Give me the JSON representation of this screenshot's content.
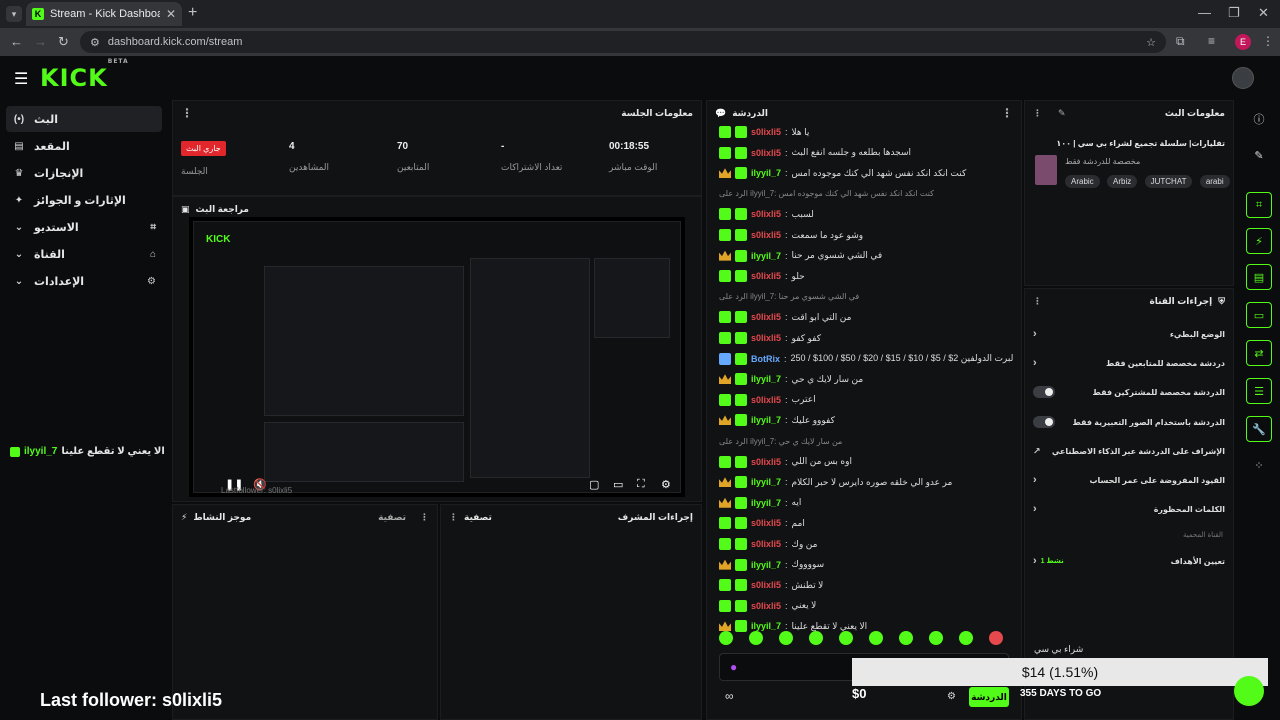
{
  "browser": {
    "tab_title": "Stream - Kick Dashboard",
    "url": "dashboard.kick.com/stream",
    "profile_letter": "E"
  },
  "sidebar": {
    "items": [
      {
        "label": "البث",
        "icon": "(•)"
      },
      {
        "label": "المقعد",
        "icon": "▤"
      },
      {
        "label": "الإنجازات",
        "icon": "🏆"
      },
      {
        "label": "الإثارات و الجوائز",
        "icon": "✦"
      },
      {
        "label": "الاستديو",
        "icon": "▾"
      },
      {
        "label": "القناة",
        "icon": "▾"
      },
      {
        "label": "الإعدادات",
        "icon": "▾"
      }
    ],
    "pinned_message_user": "ilyyil_7",
    "pinned_message_text": "الا يعني لا تقطع علينا"
  },
  "session": {
    "title": "معلومات الجلسة",
    "live_badge": "جاري البث",
    "stats": [
      {
        "value": "00:18:55",
        "label": "الوقت مباشر"
      },
      {
        "value": "-",
        "label": "تعداد الاشتراكات"
      },
      {
        "value": "70",
        "label": "المتابعين"
      },
      {
        "value": "4",
        "label": "المشاهدين"
      },
      {
        "value": "",
        "label": "الجلسة"
      }
    ]
  },
  "preview": {
    "title": "مراجعة البث",
    "logo": "KICK",
    "watermark": "Lastfollower: s0lixli5"
  },
  "activity": {
    "title": "موجز النشاط",
    "filter": "تصفية"
  },
  "mod_actions": {
    "title": "إجراءات المشرف",
    "filter": "تصفية"
  },
  "chat": {
    "title": "الدردشة",
    "button": "الدردشة",
    "lines": [
      {
        "badge": "green",
        "user": "s0lixli5",
        "ucolor": "red",
        "text": "يا هلا"
      },
      {
        "badge": "green",
        "user": "s0lixli5",
        "ucolor": "red",
        "text": "اسجدها بطلعه و جلسه انفع البث"
      },
      {
        "badge": "crown",
        "user": "ilyyil_7",
        "ucolor": "green",
        "text": "كنت انكد انكد نفس شهد الي كنك موجوده امس"
      },
      {
        "badge": "reply",
        "user": "",
        "ucolor": "",
        "text": "الرد على ilyyil_7: كنت انكد انكد نفس شهد الي كنك موجوده امس"
      },
      {
        "badge": "green",
        "user": "s0lixli5",
        "ucolor": "red",
        "text": "لسبب"
      },
      {
        "badge": "green",
        "user": "s0lixli5",
        "ucolor": "red",
        "text": "وشو عود ما سمعت"
      },
      {
        "badge": "crown",
        "user": "ilyyil_7",
        "ucolor": "green",
        "text": "في الشي شسوي مر حنا"
      },
      {
        "badge": "green",
        "user": "s0lixli5",
        "ucolor": "red",
        "text": "حلو"
      },
      {
        "badge": "reply",
        "user": "",
        "ucolor": "",
        "text": "الرد على ilyyil_7: في الشي شسوي مر حنا"
      },
      {
        "badge": "green",
        "user": "s0lixli5",
        "ucolor": "red",
        "text": "من التي ابو اقت"
      },
      {
        "badge": "green",
        "user": "s0lixli5",
        "ucolor": "red",
        "text": "كفو كفو"
      },
      {
        "badge": "bot",
        "user": "BotRix",
        "ucolor": "blue",
        "text": "البرت الدولفين 2$ / 5$ / 10$ / 15$ / 20$ / 50$ / 100$ / 250$"
      },
      {
        "badge": "crown",
        "user": "ilyyil_7",
        "ucolor": "green",
        "text": "من سار لايك ي حي"
      },
      {
        "badge": "green",
        "user": "s0lixli5",
        "ucolor": "red",
        "text": "اعترب"
      },
      {
        "badge": "crown",
        "user": "ilyyil_7",
        "ucolor": "green",
        "text": "كفووو عليك"
      },
      {
        "badge": "reply",
        "user": "",
        "ucolor": "",
        "text": "الرد على ilyyil_7: من سار لايك ي حي"
      },
      {
        "badge": "green",
        "user": "s0lixli5",
        "ucolor": "red",
        "text": "اوه بس من اللي"
      },
      {
        "badge": "crown",
        "user": "ilyyil_7",
        "ucolor": "green",
        "text": "مر عدو الي خلقه صوره دايرس لا حبر الكلام"
      },
      {
        "badge": "crown",
        "user": "ilyyil_7",
        "ucolor": "green",
        "text": "ايه"
      },
      {
        "badge": "green",
        "user": "s0lixli5",
        "ucolor": "red",
        "text": "امم"
      },
      {
        "badge": "green",
        "user": "s0lixli5",
        "ucolor": "red",
        "text": "من وك"
      },
      {
        "badge": "crown",
        "user": "ilyyil_7",
        "ucolor": "green",
        "text": "سووووك"
      },
      {
        "badge": "green",
        "user": "s0lixli5",
        "ucolor": "red",
        "text": "لا تطنش"
      },
      {
        "badge": "green",
        "user": "s0lixli5",
        "ucolor": "red",
        "text": "لا يعني"
      },
      {
        "badge": "crown",
        "user": "ilyyil_7",
        "ucolor": "green",
        "text": "الا يعني لا تقطع علينا"
      }
    ]
  },
  "stream_info": {
    "title": "معلومات البث",
    "stream_title": "تفليارات| سلسلة تجميع لشراء بي سي | ١٠٠",
    "category": "مخصصة للدردشة فقط",
    "tags": [
      "Arabic",
      "Arbiz",
      "JUTCHAT",
      "arabi"
    ]
  },
  "channel_actions": {
    "title": "إجراءات القناة",
    "items": [
      {
        "label": "الوضع البطيء",
        "type": "chev"
      },
      {
        "label": "دردشة مخصصة للمتابعين فقط",
        "type": "chev"
      },
      {
        "label": "الدردشة مخصصة للمشتركين فقط",
        "type": "toggle"
      },
      {
        "label": "الدردشة باستخدام الصور التعبيرية فقط",
        "type": "toggle"
      },
      {
        "label": "الإشراف على الدردشة عبر الذكاء الاصطناعي",
        "type": "ext"
      },
      {
        "label": "القيود المفروضة على عمر الحساب",
        "type": "chev"
      },
      {
        "label": "الكلمات المحظورة",
        "type": "chev"
      }
    ],
    "subheading": "القناة المحمية",
    "targets_label": "تعيين الأهداف",
    "targets_value": "نشط 1"
  },
  "overlays": {
    "last_follower": "Last follower: s0lixli5",
    "goal_amount": "$14 (1.51%)",
    "goal_current": "$0",
    "goal_days": "355 DAYS TO GO",
    "goal_title": "شراء بي سي"
  },
  "colors": {
    "accent": "#53fc18",
    "live": "#e1262c",
    "bg": "#0b0c0e",
    "panel": "#111214"
  }
}
